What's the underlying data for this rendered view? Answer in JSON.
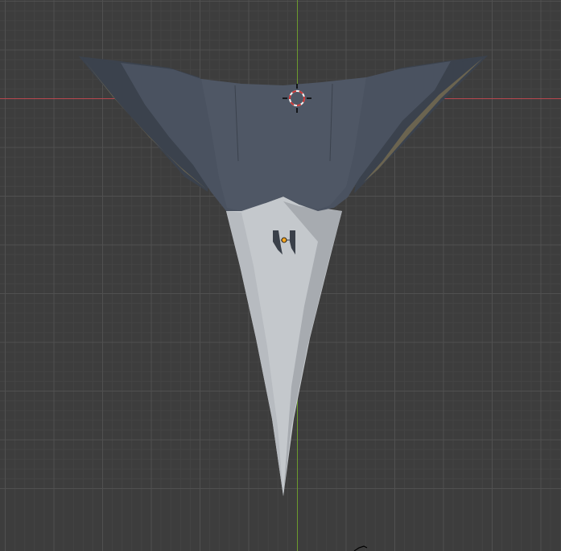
{
  "viewport": {
    "background_color": "#3d3d3d",
    "minor_grid_color": "#444444",
    "major_grid_color": "#505050",
    "x_axis_color": "#b8474f",
    "y_axis_color": "#6c9a2e",
    "cursor_ring_color": "#f2f2f2",
    "cursor_dash_color": "#cc3333",
    "origin_dot_color": "#f5a623"
  },
  "model": {
    "wing_color": "#4a5260",
    "wing_shadow_color": "#3b424d",
    "wing_highlight_color": "#5a6270",
    "nose_color": "#c4c8cc",
    "nose_shadow_color": "#a7abb0",
    "intake_color": "#3a4049",
    "edge_color": "#6b6450"
  },
  "icons": {
    "cursor": "3d-cursor-icon",
    "origin": "object-origin-icon",
    "corner": "light-object-icon"
  }
}
